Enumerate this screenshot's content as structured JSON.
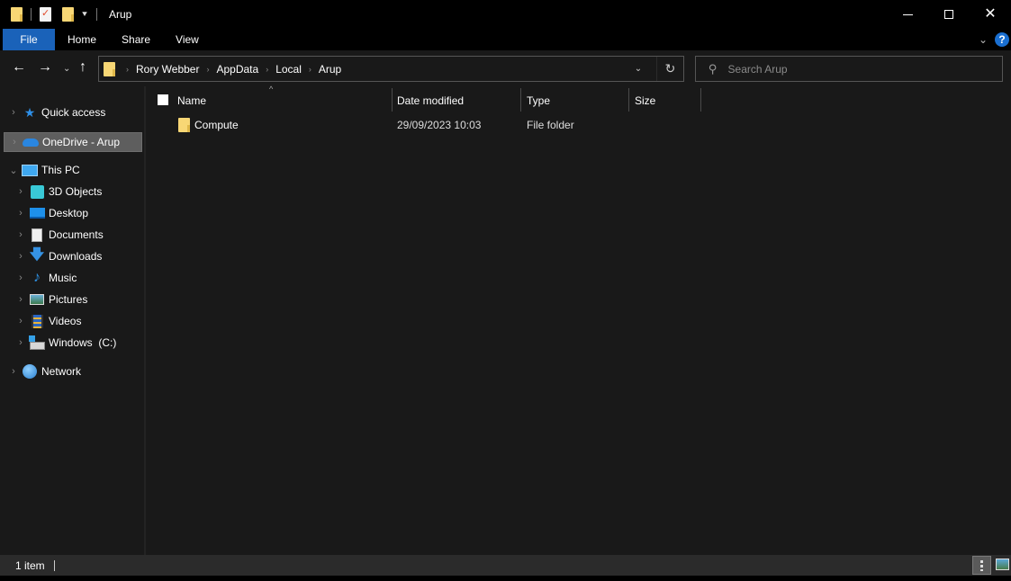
{
  "window": {
    "title": "Arup",
    "controls": {
      "minimize": "minimize",
      "maximize": "maximize",
      "close": "close"
    }
  },
  "quick_access_toolbar": {
    "icons": [
      "folder-icon",
      "properties-icon",
      "new-folder-icon"
    ],
    "dropdown_glyph": "⯆"
  },
  "ribbon": {
    "tabs": [
      {
        "label": "File",
        "active": true
      },
      {
        "label": "Home"
      },
      {
        "label": "Share"
      },
      {
        "label": "View"
      }
    ],
    "expand_glyph": "⌄",
    "help_glyph": "?"
  },
  "navigation": {
    "back_glyph": "←",
    "forward_glyph": "→",
    "recent_glyph": "⌄",
    "up_glyph": "↑",
    "breadcrumb": [
      "Rory Webber",
      "AppData",
      "Local",
      "Arup"
    ],
    "breadcrumb_sep": "›",
    "dropdown_glyph": "⌄",
    "refresh_glyph": "↻",
    "search_placeholder": "Search Arup",
    "search_glyph": "⚲"
  },
  "sidebar": {
    "items": [
      {
        "label": "Quick access",
        "icon": "star-icon",
        "chevron": "›"
      },
      {
        "label": "OneDrive - Arup",
        "icon": "onedrive-cloud-icon",
        "chevron": "›",
        "selected": true
      },
      {
        "label": "This PC",
        "icon": "computer-icon",
        "chevron": "⌄",
        "expanded": true
      },
      {
        "label": "3D Objects",
        "icon": "3d-objects-icon",
        "chevron": "›"
      },
      {
        "label": "Desktop",
        "icon": "desktop-icon",
        "chevron": "›"
      },
      {
        "label": "Documents",
        "icon": "documents-icon",
        "chevron": "›"
      },
      {
        "label": "Downloads",
        "icon": "downloads-icon",
        "chevron": "›"
      },
      {
        "label": "Music",
        "icon": "music-icon",
        "chevron": "›"
      },
      {
        "label": "Pictures",
        "icon": "pictures-icon",
        "chevron": "›"
      },
      {
        "label": "Videos",
        "icon": "videos-icon",
        "chevron": "›"
      },
      {
        "label": "Windows  (C:)",
        "icon": "drive-icon",
        "chevron": "›"
      },
      {
        "label": "Network",
        "icon": "network-icon",
        "chevron": "›"
      }
    ]
  },
  "file_list": {
    "sort_glyph": "^",
    "columns": [
      "Name",
      "Date modified",
      "Type",
      "Size"
    ],
    "rows": [
      {
        "name": "Compute",
        "date_modified": "29/09/2023 10:03",
        "type": "File folder",
        "size": ""
      }
    ]
  },
  "status_bar": {
    "item_count": "1 item",
    "views": [
      "details-view",
      "large-icons-view"
    ]
  },
  "colors": {
    "accent": "#1a62b9",
    "background": "#191919",
    "folder": "#f8d775",
    "selected_item": "#5e5e5e"
  }
}
